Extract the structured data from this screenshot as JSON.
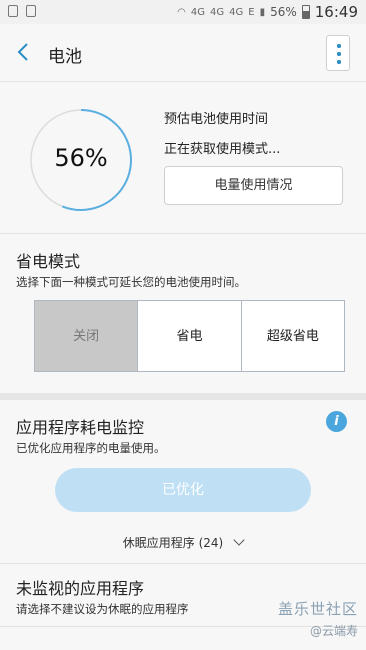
{
  "status_bar": {
    "network_labels": [
      "4G",
      "4G",
      "4G"
    ],
    "carrier_mark": "E",
    "battery": "56%",
    "time": "16:49"
  },
  "app_bar": {
    "title": "电池"
  },
  "battery_summary": {
    "percent": "56%",
    "level_fraction": 0.56,
    "estimate_label": "预估电池使用时间",
    "status": "正在获取使用模式...",
    "usage_button": "电量使用情况"
  },
  "power_saving": {
    "title": "省电模式",
    "subtitle": "选择下面一种模式可延长您的电池使用时间。",
    "modes": [
      {
        "label": "关闭",
        "selected": true
      },
      {
        "label": "省电",
        "selected": false
      },
      {
        "label": "超级省电",
        "selected": false
      }
    ]
  },
  "app_monitor": {
    "title": "应用程序耗电监控",
    "subtitle": "已优化应用程序的电量使用。",
    "optimized_button": "已优化",
    "sleeping_apps": "休眠应用程序 (24)"
  },
  "unmonitored": {
    "title": "未监视的应用程序",
    "subtitle": "请选择不建议设为休眠的应用程序"
  },
  "watermark": {
    "line1": "盖乐世社区",
    "line2": "@云端寿"
  },
  "colors": {
    "accent": "#2a8ec4",
    "info": "#4aa6dc",
    "optimized_button": "#bfe0f4",
    "selected_mode": "#c8c8c8"
  }
}
